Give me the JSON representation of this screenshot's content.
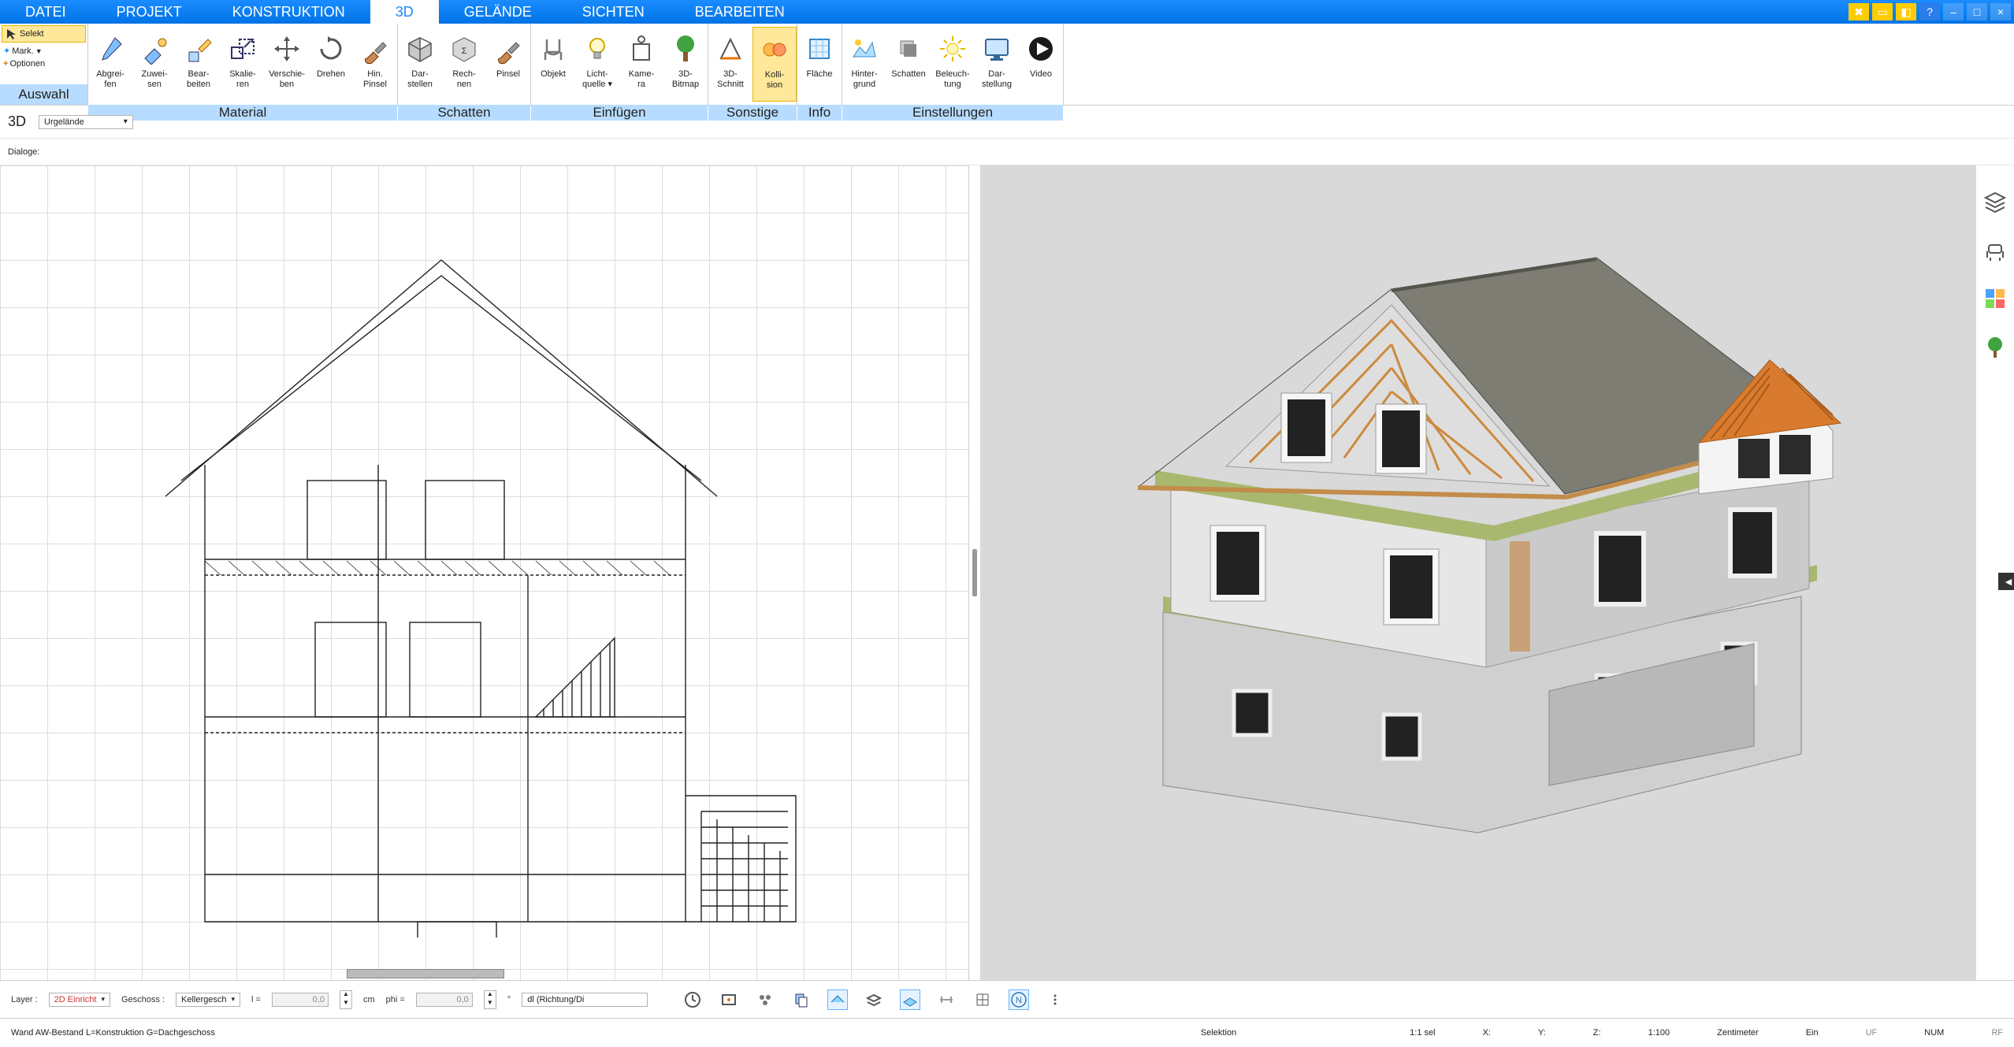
{
  "menu_tabs": [
    "DATEI",
    "PROJEKT",
    "KONSTRUKTION",
    "3D",
    "GELÄNDE",
    "SICHTEN",
    "BEARBEITEN"
  ],
  "active_tab": 3,
  "selection_panel": {
    "selekt": "Selekt",
    "mark": "Mark.",
    "optionen": "Optionen",
    "label": "Auswahl"
  },
  "groups": {
    "material": {
      "label": "Material",
      "items": [
        "Abgrei-\nfen",
        "Zuwei-\nsen",
        "Bear-\nbeiten",
        "Skalie-\nren",
        "Verschie-\nben",
        "Drehen",
        "Hin.\nPinsel"
      ]
    },
    "schatten": {
      "label": "Schatten",
      "items": [
        "Dar-\nstellen",
        "Rech-\nnen",
        "Pinsel"
      ]
    },
    "einfuegen": {
      "label": "Einfügen",
      "items": [
        "Objekt",
        "Licht-\nquelle ▾",
        "Kame-\nra",
        "3D-\nBitmap"
      ]
    },
    "sonstige": {
      "label": "Sonstige",
      "items": [
        "3D-\nSchnitt",
        "Kolli-\nsion"
      ],
      "active": 1
    },
    "info": {
      "label": "Info",
      "items": [
        "Fläche"
      ]
    },
    "einstellungen": {
      "label": "Einstellungen",
      "items": [
        "Hinter-\ngrund",
        "Schatten",
        "Beleuch-\ntung",
        "Dar-\nstellung",
        "Video"
      ]
    }
  },
  "subbar": {
    "tag": "3D",
    "combo": "Urgelände"
  },
  "dialoge": "Dialoge:",
  "bottom": {
    "layer_lbl": "Layer :",
    "layer_val": "2D Einricht",
    "geschoss_lbl": "Geschoss :",
    "geschoss_val": "Kellergesch",
    "l_lbl": "l =",
    "l_val": "0,0",
    "cm": "cm",
    "phi_lbl": "phi =",
    "phi_val": "0,0",
    "deg": "°",
    "dl": "dl (Richtung/Di"
  },
  "status": {
    "left": "Wand AW-Bestand L=Konstruktion G=Dachgeschoss",
    "selektion": "Selektion",
    "ratio": "1:1 sel",
    "x": "X:",
    "y": "Y:",
    "z": "Z:",
    "scale": "1:100",
    "unit": "Zentimeter",
    "ein": "Ein",
    "uf": "UF",
    "num": "NUM",
    "rf": "RF"
  }
}
